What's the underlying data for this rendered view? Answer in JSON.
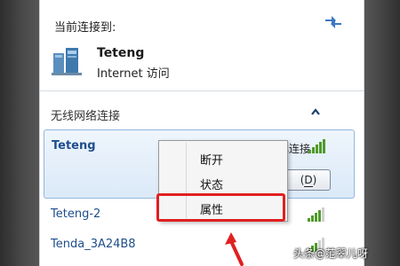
{
  "current_connection": {
    "title": "当前连接到:",
    "network_name": "Teteng",
    "status": "Internet 访问"
  },
  "wireless": {
    "header": "无线网络连接",
    "selected": {
      "name": "Teteng",
      "status": "已连接",
      "button_accel": "D"
    },
    "networks": [
      {
        "name": "Teteng-2"
      },
      {
        "name": "Tenda_3A24B8"
      }
    ]
  },
  "context_menu": {
    "items": [
      "断开",
      "状态",
      "属性"
    ]
  },
  "watermark": "头条@范翠儿呀",
  "colors": {
    "highlight": "#e02020",
    "signal": "#4f9a2a",
    "link": "#1e4e8c"
  }
}
